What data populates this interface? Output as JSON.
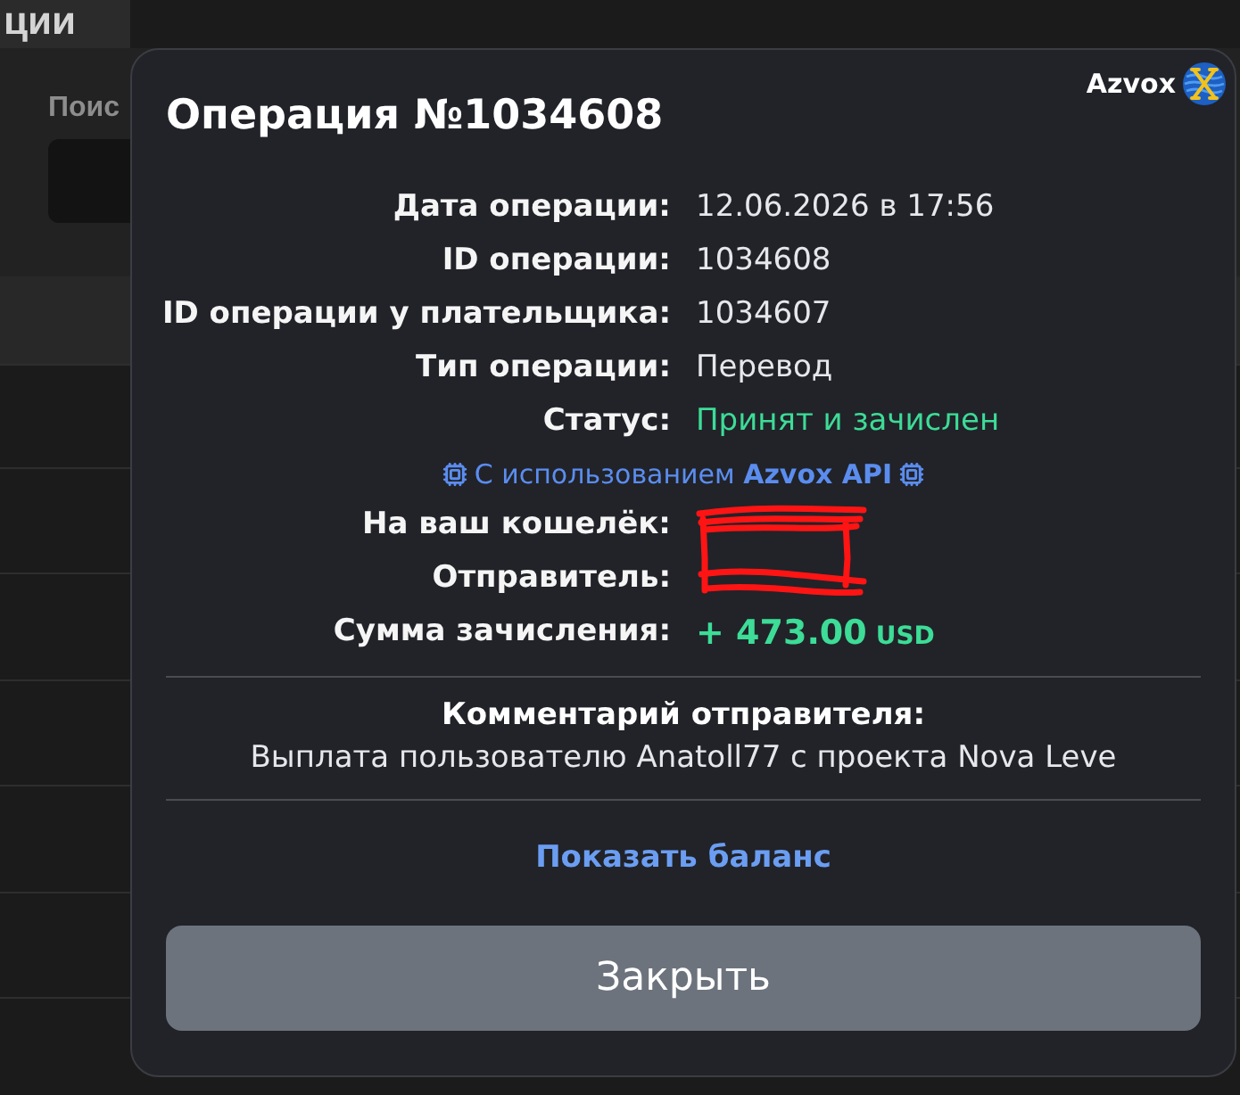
{
  "background": {
    "title": "ции",
    "search_label": "Поис"
  },
  "modal": {
    "brand": "Azvox",
    "title": "Операция №1034608",
    "details": [
      {
        "label": "Дата операции:",
        "value": "12.06.2026 в 17:56",
        "kind": "text"
      },
      {
        "label": "ID операции:",
        "value": "1034608",
        "kind": "text"
      },
      {
        "label": "ID операции у плательщика:",
        "value": "1034607",
        "kind": "text"
      },
      {
        "label": "Тип операции:",
        "value": "Перевод",
        "kind": "text"
      },
      {
        "label": "Статус:",
        "value": "Принят и зачислен",
        "kind": "status"
      }
    ],
    "api_note": "С использованием **Azvox API**",
    "transfer": [
      {
        "label": "На ваш кошелёк:",
        "kind": "redacted"
      },
      {
        "label": "Отправитель:",
        "kind": "redacted"
      },
      {
        "label": "Сумма зачисления:",
        "value": "+ 473.00",
        "currency": "USD",
        "kind": "amount"
      }
    ],
    "comment_title": "Комментарий отправителя:",
    "comment": "Выплата пользователю Anatoll77 с проекта Nova Leve",
    "balance_link": "Показать баланс",
    "close_button": "Закрыть"
  }
}
